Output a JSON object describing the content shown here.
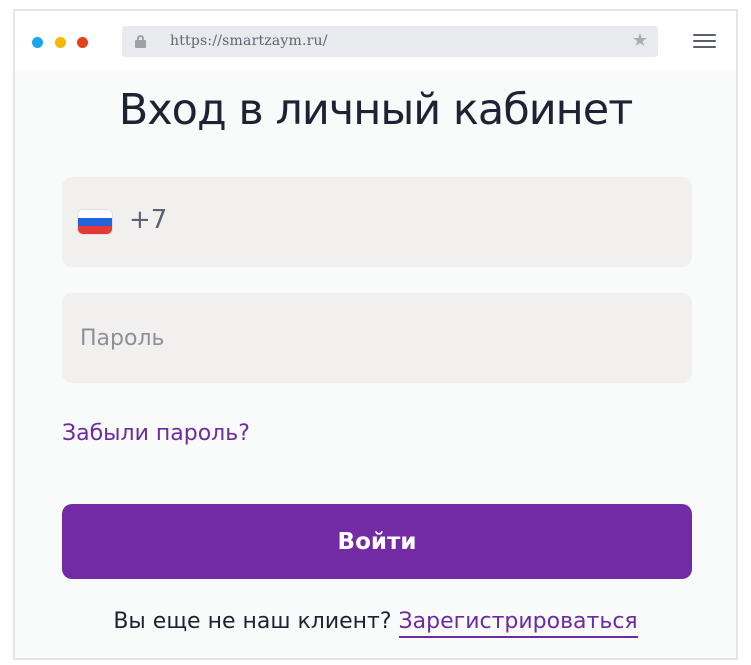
{
  "browser": {
    "url": "https://smartzaym.ru/",
    "icons": {
      "lock": "lock-icon",
      "bookmark": "star-icon",
      "menu": "hamburger-menu-icon"
    }
  },
  "login": {
    "title": "Вход в личный кабинет",
    "phone": {
      "prefix": "+7",
      "flag": "russia-flag-icon",
      "value": ""
    },
    "password": {
      "placeholder": "Пароль",
      "value": ""
    },
    "forgot_link": "Забыли пароль?",
    "submit_label": "Войти",
    "register_prompt": "Вы еще не наш клиент?",
    "register_link": "Зарегистрироваться"
  },
  "colors": {
    "accent": "#722ba5",
    "link": "#6c2ba3",
    "field_bg": "#f1f0ef",
    "title": "#1f2233"
  }
}
